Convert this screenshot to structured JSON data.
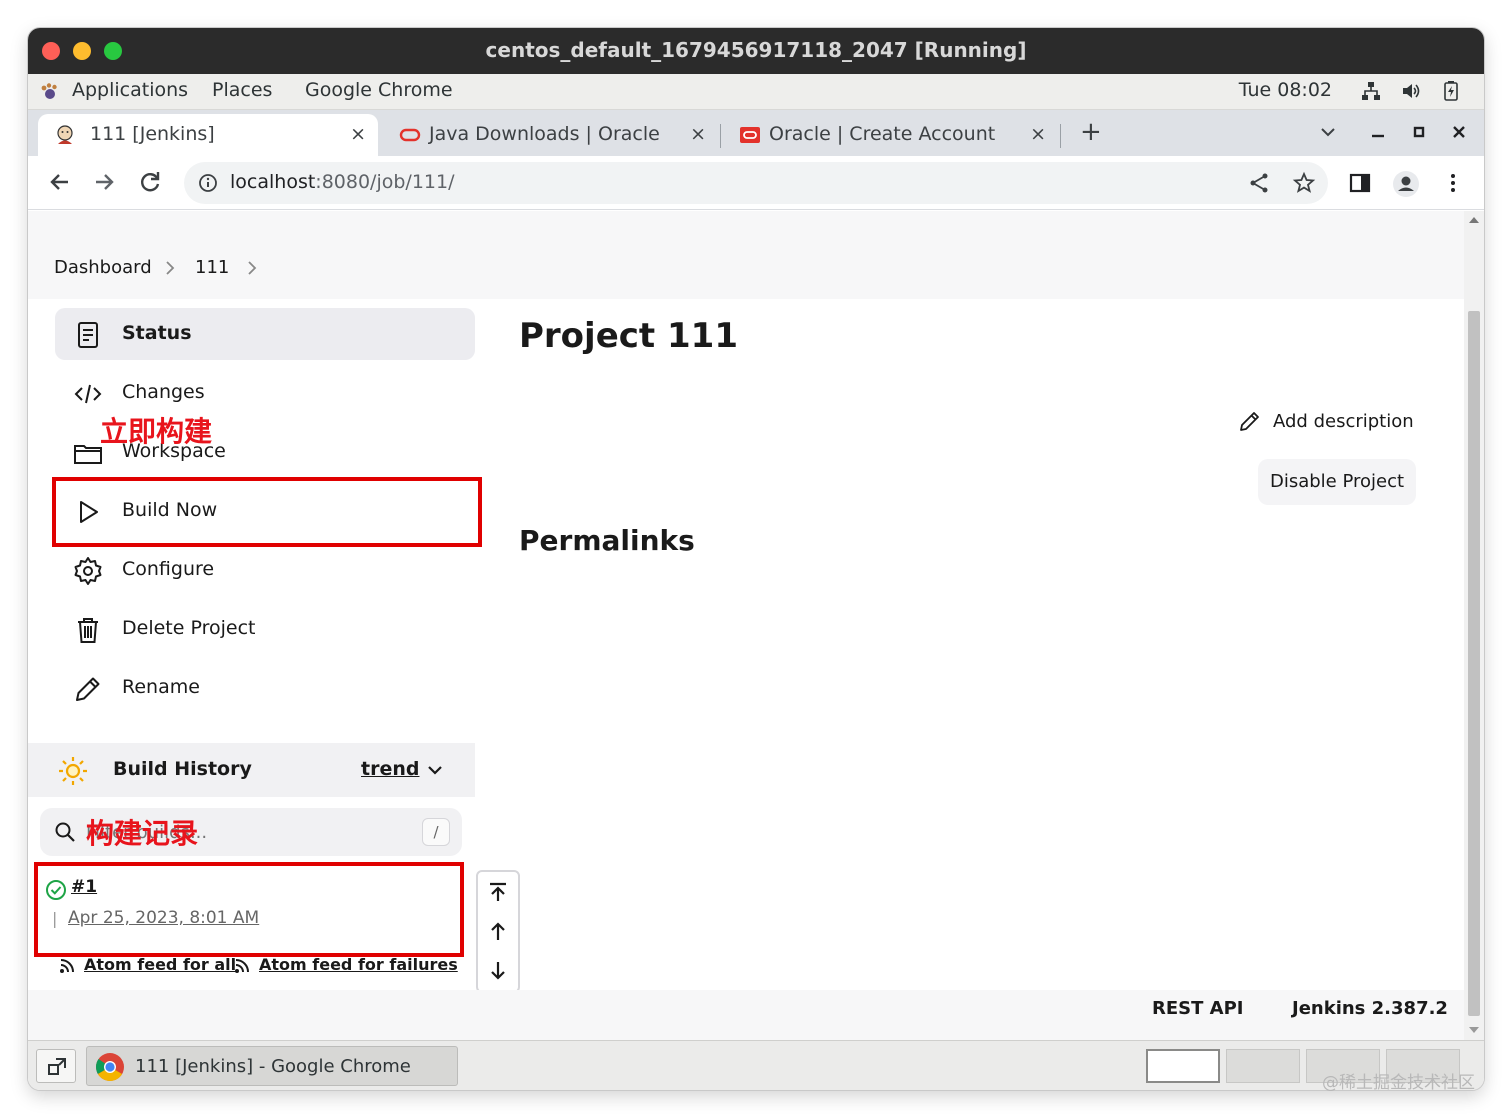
{
  "mac": {
    "title": "centos_default_1679456917118_2047 [Running]"
  },
  "gnome": {
    "applications": "Applications",
    "places": "Places",
    "chrome": "Google Chrome",
    "clock": "Tue 08:02"
  },
  "tabs": [
    {
      "title": "111 [Jenkins]",
      "icon": "jenkins-icon",
      "active": true
    },
    {
      "title": "Java Downloads | Oracle",
      "icon": "oracle-icon",
      "active": false
    },
    {
      "title": "Oracle | Create Account",
      "icon": "oracle-account-icon",
      "active": false
    }
  ],
  "tab_close": "×",
  "new_tab": "+",
  "address": {
    "host": "localhost",
    "rest": ":8080/job/111/"
  },
  "breadcrumb": [
    "Dashboard",
    "111"
  ],
  "sidebar": {
    "items": [
      {
        "label": "Status",
        "icon": "status-icon"
      },
      {
        "label": "Changes",
        "icon": "code-icon"
      },
      {
        "label": "Workspace",
        "icon": "folder-icon"
      },
      {
        "label": "Build Now",
        "icon": "play-icon"
      },
      {
        "label": "Configure",
        "icon": "gear-icon"
      },
      {
        "label": "Delete Project",
        "icon": "trash-icon"
      },
      {
        "label": "Rename",
        "icon": "pencil-icon"
      }
    ]
  },
  "main": {
    "title": "Project 111",
    "add_description": "Add description",
    "disable_project": "Disable Project",
    "permalinks": "Permalinks"
  },
  "build_history": {
    "title": "Build History",
    "trend": "trend",
    "search_placeholder": "Filter builds...",
    "slash": "/",
    "builds": [
      {
        "number": "#1",
        "date": "Apr 25, 2023, 8:01 AM",
        "status": "success"
      }
    ],
    "separator": "|",
    "feed_all": "Atom feed for all",
    "feed_failures": "Atom feed for failures"
  },
  "footer": {
    "rest_api": "REST API",
    "version": "Jenkins 2.387.2"
  },
  "annotations": {
    "build_now": "立即构建",
    "build_history": "构建记录"
  },
  "taskbar": {
    "window_label": "111 [Jenkins] - Google Chrome"
  },
  "watermark": "@稀土掘金技术社区",
  "colors": {
    "annotation": "#e00000",
    "success": "#1ea446",
    "mac_bar": "#2b2b2b"
  }
}
